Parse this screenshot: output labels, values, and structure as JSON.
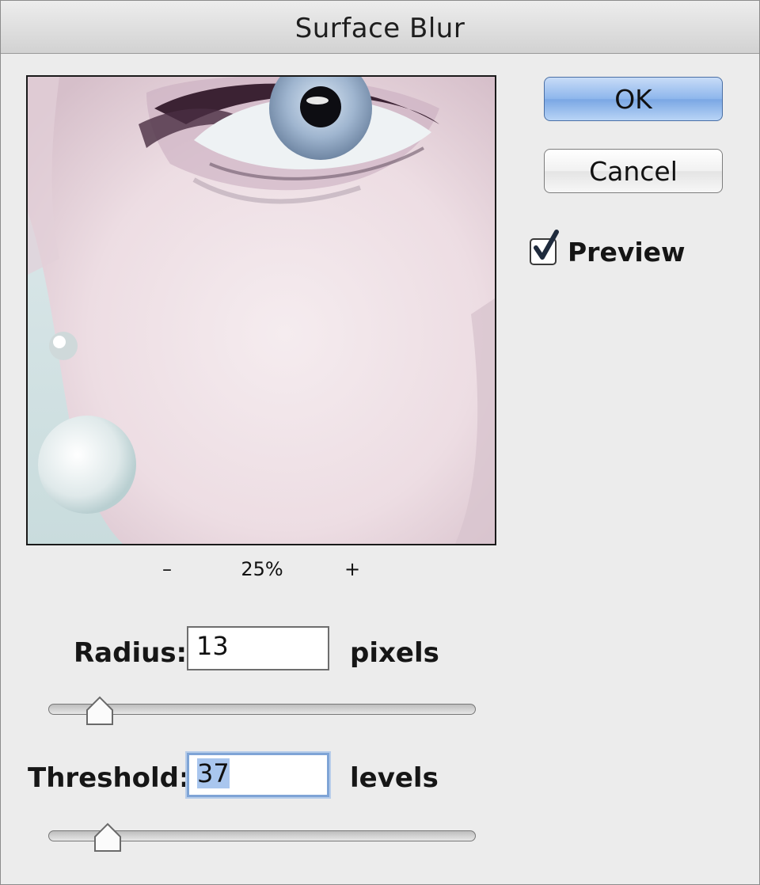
{
  "dialog": {
    "title": "Surface Blur"
  },
  "buttons": {
    "ok_label": "OK",
    "cancel_label": "Cancel"
  },
  "preview_toggle": {
    "label": "Preview",
    "checked": true
  },
  "zoom": {
    "minus": "–",
    "level": "25%",
    "plus": "+"
  },
  "radius": {
    "label": "Radius:",
    "value": "13",
    "unit": "pixels",
    "slider_fraction": 0.12
  },
  "threshold": {
    "label": "Threshold:",
    "value": "37",
    "unit": "levels",
    "slider_fraction": 0.14
  },
  "colors": {
    "ok_button": "#8db6ec",
    "focus_ring": "#7fa4d6",
    "selection": "#a9c6ee"
  }
}
